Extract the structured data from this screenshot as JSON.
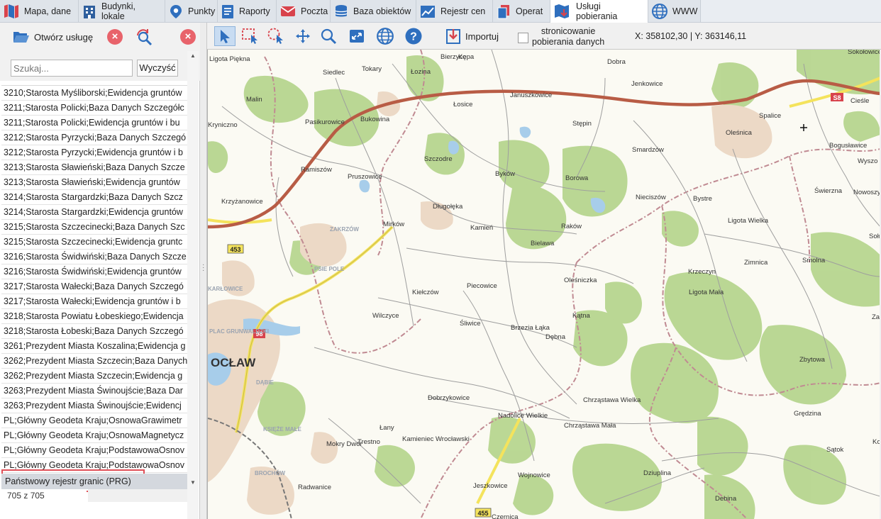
{
  "tabs": [
    {
      "label": "Mapa, dane",
      "icon": "map-icon"
    },
    {
      "label": "Budynki, lokale",
      "icon": "building-icon"
    },
    {
      "label": "Punkty",
      "icon": "pin-icon"
    },
    {
      "label": "Raporty",
      "icon": "report-icon"
    },
    {
      "label": "Poczta",
      "icon": "mail-icon"
    },
    {
      "label": "Baza obiektów",
      "icon": "database-icon"
    },
    {
      "label": "Rejestr cen",
      "icon": "chart-icon"
    },
    {
      "label": "Operat",
      "icon": "document-icon"
    },
    {
      "label": "Usługi pobierania",
      "icon": "download-map-icon",
      "active": true
    },
    {
      "label": "WWW",
      "icon": "globe-icon"
    }
  ],
  "left_panel": {
    "open_service_label": "Otwórz usługę",
    "search_placeholder": "Szukaj...",
    "clear_label": "Wyczyść",
    "rows": [
      "3210;Starosta Myśliborski;Ewidencja gruntów",
      "3211;Starosta Policki;Baza Danych Szczegółc",
      "3211;Starosta Policki;Ewidencja gruntów i bu",
      "3212;Starosta Pyrzycki;Baza Danych Szczegó",
      "3212;Starosta Pyrzycki;Ewidencja gruntów i b",
      "3213;Starosta Sławieński;Baza Danych Szcze",
      "3213;Starosta Sławieński;Ewidencja gruntów",
      "3214;Starosta Stargardzki;Baza Danych Szcz",
      "3214;Starosta Stargardzki;Ewidencja gruntów",
      "3215;Starosta Szczecinecki;Baza Danych Szc",
      "3215;Starosta Szczecinecki;Ewidencja gruntc",
      "3216;Starosta Świdwiński;Baza Danych Szcze",
      "3216;Starosta Świdwiński;Ewidencja gruntów",
      "3217;Starosta Wałecki;Baza Danych Szczegó",
      "3217;Starosta Wałecki;Ewidencja gruntów i b",
      "3218;Starosta Powiatu Łobeskiego;Ewidencja",
      "3218;Starosta Łobeski;Baza Danych Szczegó",
      "3261;Prezydent Miasta Koszalina;Ewidencja g",
      "3262;Prezydent Miasta Szczecin;Baza Danych",
      "3262;Prezydent Miasta Szczecin;Ewidencja g",
      "3263;Prezydent Miasta Świnoujście;Baza Dar",
      "3263;Prezydent Miasta Świnoujście;Ewidencj",
      "PL;Główny Geodeta Kraju;OsnowaGrawimetr",
      "PL;Główny Geodeta Kraju;OsnowaMagnetycz",
      "PL;Główny Geodeta Kraju;PodstawowaOsnov",
      "PL;Główny Geodeta Kraju;PodstawowaOsnov"
    ],
    "selected_row": "Państwowy rejestr granic (PRG)",
    "count": "705 z 705"
  },
  "map_toolbar": {
    "import_label": "Importuj",
    "paging_line1": "stronicowanie",
    "paging_line2": "pobierania danych",
    "coords": "X: 358102,30 | Y: 363146,11"
  },
  "map_labels": {
    "towns": [
      "Ligota Piękna",
      "Siedlec",
      "Tokary",
      "Łozina",
      "Bierzyce",
      "Kępa",
      "Dobra",
      "Sokołowice",
      "Malin",
      "Januszkowice",
      "Jenkowice",
      "Łosice",
      "Cieśle",
      "Kryniczno",
      "Pasikurowice",
      "Bukowina",
      "Stępin",
      "Spalice",
      "Oleśnica",
      "Bogusławice",
      "Smardzów",
      "Szczodre",
      "Wyszo",
      "Ramiszów",
      "Pruszowice",
      "Byków",
      "Borowa",
      "Świerzna",
      "Nowoszyc",
      "Krzyżanowice",
      "Długołęka",
      "Nieciszów",
      "Bystre",
      "Mirków",
      "Kamień",
      "Raków",
      "Ligota Wielka",
      "Sołniki Wielkie",
      "Bielawa",
      "Smolna",
      "Zimnica",
      "Krzeczyn",
      "Kiełczów",
      "Piecowice",
      "Oleśniczka",
      "Ligota Mała",
      "Wilczyce",
      "Śliwice",
      "Brzezia Łąka",
      "Kątna",
      "Dębna",
      "Zawido",
      "Zbytowa",
      "Dobrzykowice",
      "Chrząstawa Wielka",
      "Nadolice Wielkie",
      "Chrząstawa Mała",
      "Grędzina",
      "Łany",
      "Mokry Dwór",
      "Trestno",
      "Kamieniec Wrocławski",
      "Sątok",
      "Dziuplina",
      "Wojnowice",
      "Jeszkowice",
      "Radwanice",
      "Czernica",
      "Debina",
      "Kosz"
    ],
    "districts": [
      "ZAKRZÓW",
      "PSIE POLE",
      "KARŁOWICE",
      "PLAC GRUNWALDZKI",
      "DĄBIE",
      "KSIĘŻE MAŁE",
      "BROCHÓW"
    ],
    "city": "OCŁAW",
    "roads": [
      "S8",
      "453",
      "98",
      "455"
    ]
  },
  "colors": {
    "accent_blue": "#1e72c8",
    "active_tab": "#ffffff",
    "close_red": "#e8636b",
    "highlight_red": "#e05058",
    "forest": "#b7d68f",
    "urban": "#ecd9c6",
    "expressway": "#b85c45",
    "main_road": "#f4e35c",
    "boundary": "#c08a92",
    "water": "#a7cdea"
  }
}
